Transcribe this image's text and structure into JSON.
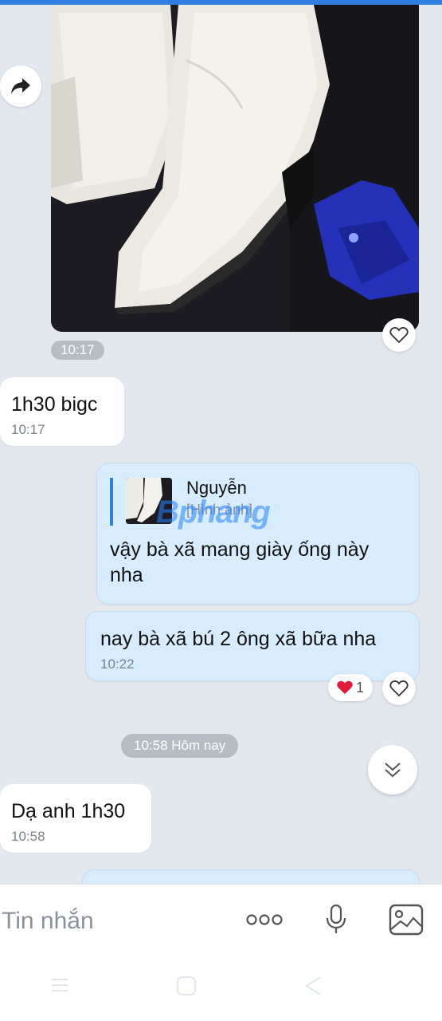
{
  "messages": {
    "photo_time": "10:17",
    "msg1": {
      "text": "1h30 bigc",
      "time": "10:17"
    },
    "reply": {
      "quote_name": "Nguyễn",
      "quote_sub": "[Hình ảnh]",
      "text": "vậy bà xã mang giày ống này nha"
    },
    "msg3": {
      "text": "nay bà xã bú 2 ông xã bữa nha",
      "time": "10:22",
      "reaction_count": "1"
    },
    "day_separator": "10:58 Hôm nay",
    "msg4": {
      "text": "Dạ anh 1h30",
      "time": "10:58"
    }
  },
  "watermark": "Bphang",
  "composer": {
    "placeholder": "Tin nhắn"
  },
  "icons": {
    "forward": "forward-icon",
    "heart": "heart-icon",
    "scroll_down": "chevron-double-down-icon",
    "more": "more-icon",
    "mic": "microphone-icon",
    "image": "image-icon"
  },
  "colors": {
    "accent": "#2f7fe0",
    "outgoing_bubble": "#d7ecfd",
    "incoming_bubble": "#ffffff",
    "chat_bg": "#e3e8ef"
  }
}
